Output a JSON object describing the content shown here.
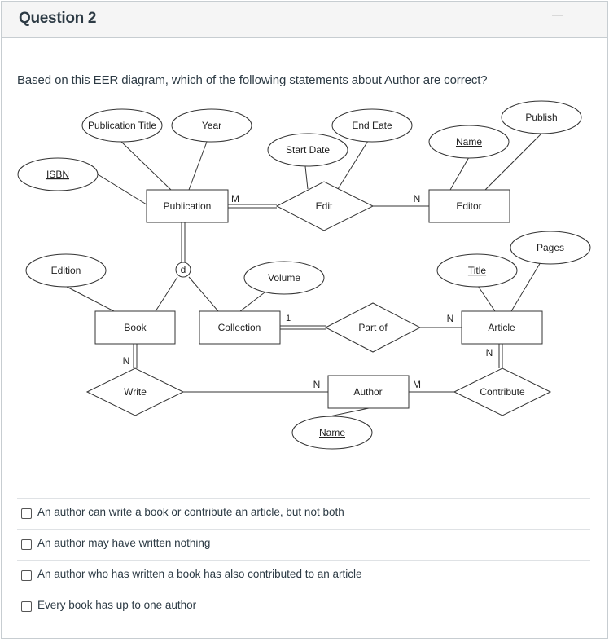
{
  "question": {
    "title": "Question 2",
    "prompt": "Based on this EER diagram, which of the following statements about Author are correct?"
  },
  "diagram": {
    "entities": {
      "publication": "Publication",
      "editor": "Editor",
      "book": "Book",
      "collection": "Collection",
      "article": "Article",
      "author": "Author"
    },
    "relationships": {
      "edit": "Edit",
      "part_of": "Part of",
      "write": "Write",
      "contribute": "Contribute"
    },
    "attributes": {
      "isbn": "ISBN",
      "publication_title": "Publication Title",
      "year": "Year",
      "start_date": "Start Date",
      "end_date": "End Eate",
      "editor_name": "Name",
      "publish": "Publish",
      "edition": "Edition",
      "volume": "Volume",
      "title": "Title",
      "pages": "Pages",
      "author_name": "Name"
    },
    "disjoint_symbol": "d",
    "cardinalities": {
      "publication_edit": "M",
      "edit_editor": "N",
      "collection_partof": "1",
      "partof_article": "N",
      "book_write": "N",
      "write_author": "N",
      "author_contribute": "M",
      "article_contribute": "N"
    }
  },
  "answers": [
    {
      "label": "An author can write a book or contribute an article, but not both",
      "checked": false
    },
    {
      "label": "An author may have written nothing",
      "checked": false
    },
    {
      "label": "An author who has written a book has also contributed to an article",
      "checked": false
    },
    {
      "label": "Every book has up to one author",
      "checked": false
    }
  ]
}
